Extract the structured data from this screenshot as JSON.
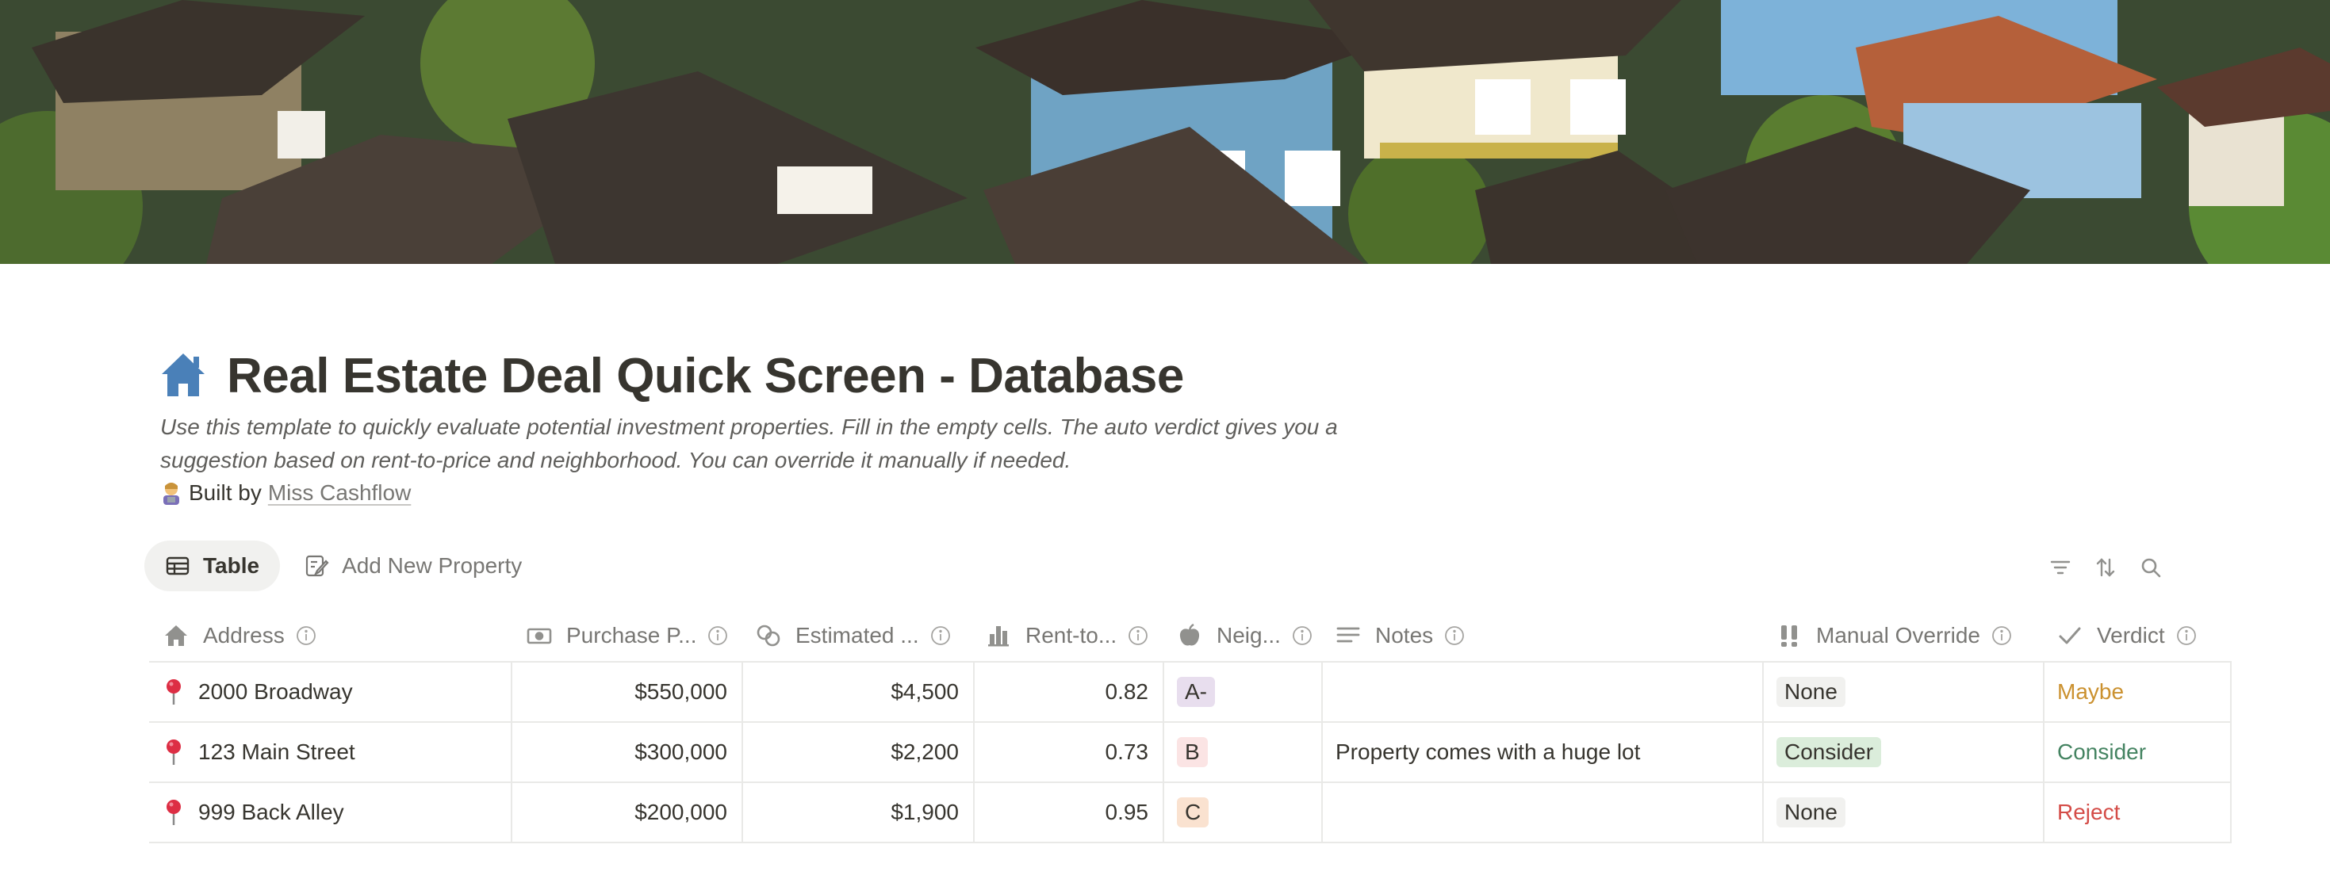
{
  "page": {
    "title": "Real Estate Deal Quick Screen - Database",
    "title_icon": "house-icon",
    "description": "Use this template to quickly evaluate potential investment properties. Fill in the empty cells. The auto verdict gives you a suggestion based on rent-to-price and neighborhood. You can override it manually if needed.",
    "built_by_prefix": "Built by",
    "built_by_link": "Miss Cashflow"
  },
  "views": [
    {
      "label": "Table",
      "icon": "table-icon",
      "active": true
    },
    {
      "label": "Add New Property",
      "icon": "edit-form-icon",
      "active": false
    }
  ],
  "toolbar": {
    "icons": [
      "filter-icon",
      "sort-icon",
      "search-icon"
    ]
  },
  "table": {
    "columns": [
      {
        "label": "Address",
        "icon": "house-icon"
      },
      {
        "label": "Purchase P...",
        "icon": "money-icon"
      },
      {
        "label": "Estimated ...",
        "icon": "coins-icon"
      },
      {
        "label": "Rent-to...",
        "icon": "bar-chart-icon"
      },
      {
        "label": "Neig...",
        "icon": "apple-icon"
      },
      {
        "label": "Notes",
        "icon": "text-lines-icon"
      },
      {
        "label": "Manual Override",
        "icon": "double-exclamation-icon"
      },
      {
        "label": "Verdict",
        "icon": "checkmark-icon"
      }
    ],
    "rows": [
      {
        "address": "2000 Broadway",
        "price": "$550,000",
        "rent": "$4,500",
        "ratio": "0.82",
        "grade": "A-",
        "notes": "",
        "override": "None",
        "verdict": "Maybe"
      },
      {
        "address": "123 Main Street",
        "price": "$300,000",
        "rent": "$2,200",
        "ratio": "0.73",
        "grade": "B",
        "notes": "Property comes with a huge lot",
        "override": "Consider",
        "verdict": "Consider"
      },
      {
        "address": "999 Back Alley",
        "price": "$200,000",
        "rent": "$1,900",
        "ratio": "0.95",
        "grade": "C",
        "notes": "",
        "override": "None",
        "verdict": "Reject"
      }
    ]
  },
  "colors": {
    "grade_a_bg": "#e8deee",
    "grade_b_bg": "#fbe4e4",
    "grade_c_bg": "#fae2d0",
    "override_none_bg": "#f1f1ef",
    "override_consider_bg": "#dbeddb",
    "verdict_maybe": "#cb912f",
    "verdict_consider": "#448361",
    "verdict_reject": "#d44c47",
    "title_icon": "#4a80b8"
  }
}
